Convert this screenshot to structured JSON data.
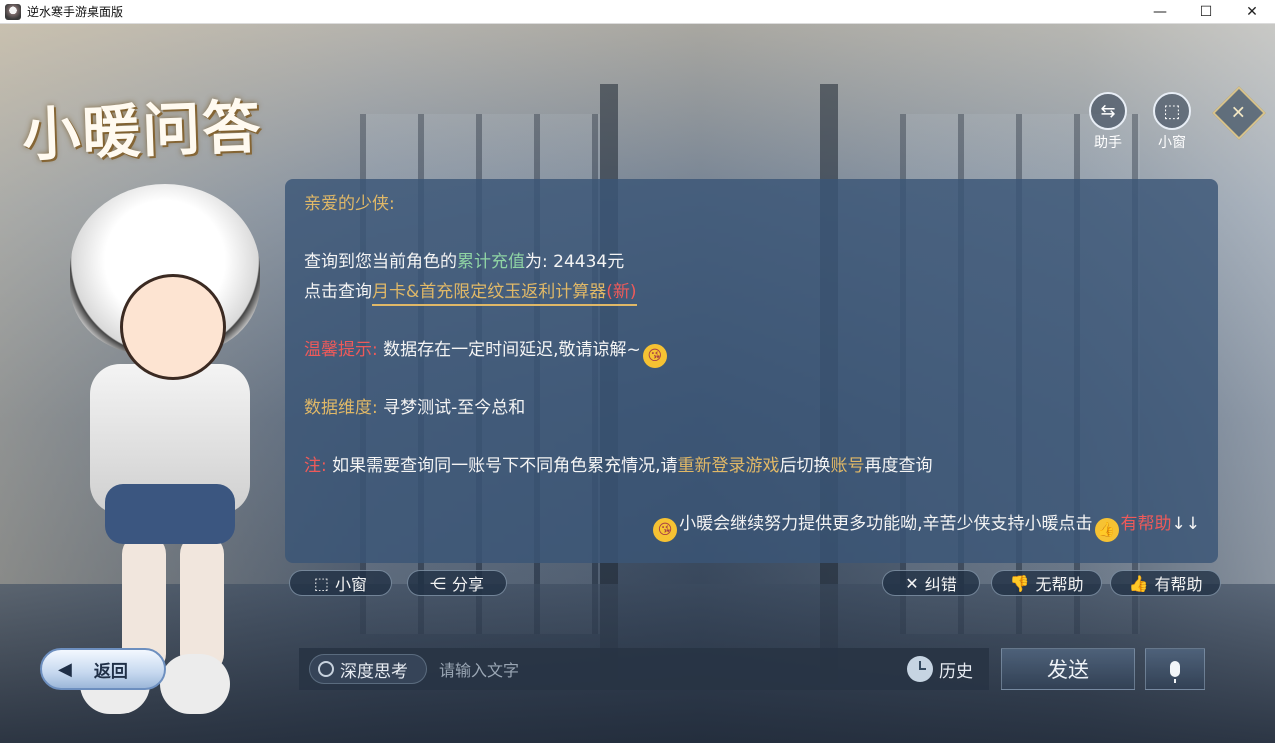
{
  "window": {
    "title": "逆水寒手游桌面版",
    "minimize_glyph": "—",
    "maximize_glyph": "☐",
    "close_glyph": "✕"
  },
  "header": {
    "banner": "小暖问答",
    "assistant_label": "助手",
    "miniwindow_label": "小窗"
  },
  "dialog": {
    "greeting": "亲爱的少侠:",
    "query_prefix": "查询到您当前角色的",
    "query_key": "累计充值",
    "query_suffix": "为: 24434元",
    "calc_prefix": "点击查询",
    "calc_link": "月卡&首充限定纹玉返利计算器",
    "calc_new": "(新)",
    "tip_label": "温馨提示:",
    "tip_text": " 数据存在一定时间延迟,敬请谅解~",
    "dimension_label": "数据维度:",
    "dimension_text": " 寻梦测试-至今总和",
    "note_label": "注:",
    "note_text_1": " 如果需要查询同一账号下不同角色累充情况,请",
    "note_relogin": "重新登录游戏",
    "note_text_2": "后切换",
    "note_account": "账号",
    "note_text_3": "再度查询",
    "footer_text": "小暖会继续努力提供更多功能呦,辛苦少侠支持小暖点击",
    "footer_helpful": "有帮助",
    "footer_arrows": "↓↓"
  },
  "actions": {
    "miniwindow": "小窗",
    "share": "分享",
    "correct": "纠错",
    "not_helpful": "无帮助",
    "helpful": "有帮助"
  },
  "bottom": {
    "back": "返回",
    "deep_think": "深度思考",
    "input_placeholder": "请输入文字",
    "history": "历史",
    "send": "发送"
  },
  "colors": {
    "accent_gold": "#e0b867",
    "accent_green": "#8fd4a4",
    "accent_red": "#ee5a5a",
    "dialog_bg": "#3a5676"
  }
}
